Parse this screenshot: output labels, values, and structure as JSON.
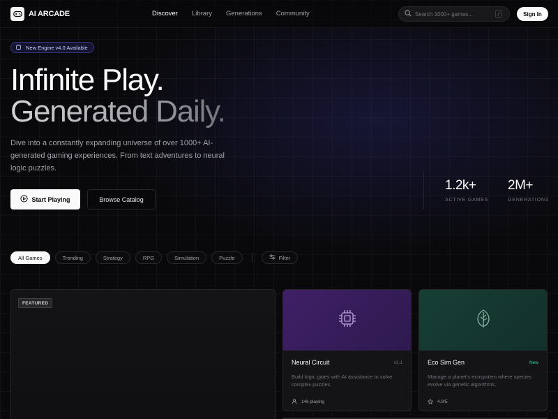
{
  "brand": {
    "name": "AI ARCADE"
  },
  "nav": {
    "links": [
      "Discover",
      "Library",
      "Generations",
      "Community"
    ],
    "active": "Discover",
    "search_placeholder": "Search 1000+ games...",
    "search_shortcut": "/",
    "signin": "Sign In"
  },
  "hero": {
    "badge": "New Engine v4.0 Available",
    "title_line1": "Infinite Play.",
    "title_line2": "Generated Daily.",
    "description": "Dive into a constantly expanding universe of over 1000+ AI-generated gaming experiences. From text adventures to neural logic puzzles.",
    "primary_cta": "Start Playing",
    "secondary_cta": "Browse Catalog",
    "stats": [
      {
        "value": "1.2k+",
        "label": "ACTIVE GAMES"
      },
      {
        "value": "2M+",
        "label": "GENERATIONS"
      }
    ]
  },
  "filters": {
    "chips": [
      "All Games",
      "Trending",
      "Strategy",
      "RPG",
      "Simulation",
      "Puzzle"
    ],
    "active": "All Games",
    "filter_label": "Filter"
  },
  "featured": {
    "tag": "FEATURED"
  },
  "cards": [
    {
      "title": "Neural Circuit",
      "tag": "v2.1",
      "tag_color": "#71717a",
      "description": "Build logic gates with AI assistance to solve complex puzzles.",
      "meta": "14k playing",
      "icon": "cpu-icon",
      "accent": "#3b1d5e"
    },
    {
      "title": "Eco Sim Gen",
      "tag": "New",
      "tag_color": "#34d399",
      "description": "Manage a planet's ecosystem where species evolve via genetic algorithms.",
      "meta": "4.9/5",
      "icon": "leaf-icon",
      "accent": "#12352d"
    }
  ],
  "colors": {
    "background": "#09090b",
    "accent_indigo": "#6366f1",
    "success_green": "#34d399"
  }
}
